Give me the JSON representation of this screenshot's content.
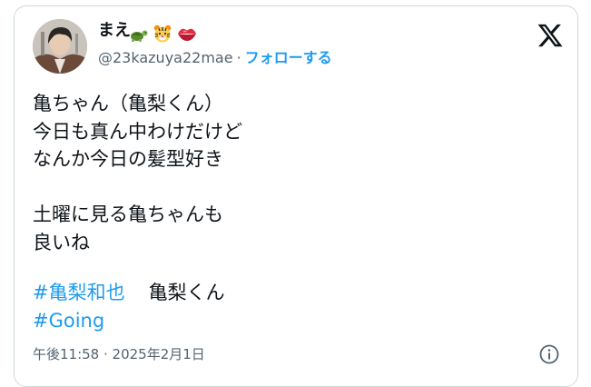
{
  "author": {
    "name": "まえ",
    "emojis": [
      "turtle-emoji",
      "tiger-face-emoji",
      "kiss-mark-emoji"
    ],
    "handle": "@23kazuya22mae",
    "separator": "·",
    "follow_label": "フォローする"
  },
  "tweet": {
    "lines": [
      "亀ちゃん（亀梨くん）",
      "今日も真ん中わけだけど",
      "なんか今日の髪型好き",
      "",
      "土曜に見る亀ちゃんも",
      "良いね"
    ],
    "hashtag_1": "#亀梨和也",
    "plain_word": "亀梨くん",
    "hashtag_2": "#Going",
    "timestamp": "午後11:58 · 2025年2月1日"
  },
  "icons": {
    "platform_logo": "x-logo-icon",
    "info": "info-icon"
  },
  "colors": {
    "link": "#1d9bf0",
    "text": "#0f1419",
    "secondary": "#536471",
    "border": "#cfd9de"
  }
}
